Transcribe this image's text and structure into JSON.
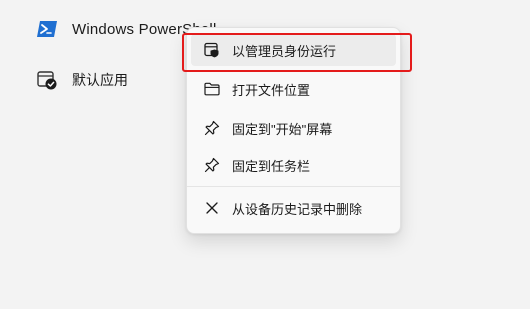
{
  "app": {
    "title": "Windows PowerShell",
    "icon": "powershell-icon"
  },
  "left_list": {
    "default_app_label": "默认应用",
    "default_app_icon": "default-app-icon"
  },
  "context_menu": {
    "items": [
      {
        "label": "以管理员身份运行",
        "icon": "shield-window-icon",
        "hovered": true
      },
      {
        "label": "打开文件位置",
        "icon": "folder-icon"
      },
      {
        "label": "固定到\"开始\"屏幕",
        "icon": "pin-icon"
      },
      {
        "label": "固定到任务栏",
        "icon": "pin-icon"
      },
      {
        "label": "从设备历史记录中删除",
        "icon": "close-icon"
      }
    ]
  },
  "colors": {
    "highlight_border": "#e41b1b",
    "powershell_blue": "#1f6fd1",
    "menu_background": "#f9f9f9",
    "page_background": "#f3f3f3"
  }
}
